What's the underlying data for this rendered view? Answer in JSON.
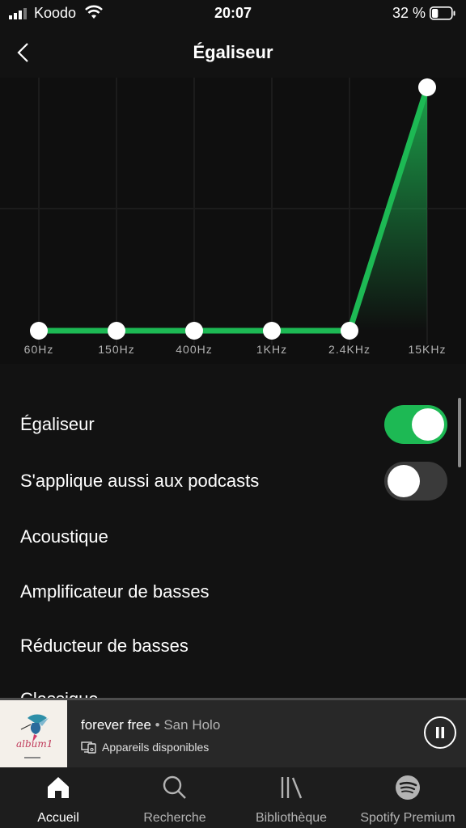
{
  "status": {
    "carrier": "Koodo",
    "time": "20:07",
    "battery": "32 %",
    "battery_level_percent": 32
  },
  "header": {
    "title": "Égaliseur",
    "back_icon": "chevron-left-icon"
  },
  "equalizer": {
    "bands": [
      "60Hz",
      "150Hz",
      "400Hz",
      "1KHz",
      "2.4KHz",
      "15KHz"
    ],
    "levels": [
      0,
      0,
      0,
      0,
      0,
      1
    ],
    "accent": "#1db954"
  },
  "settings": [
    {
      "label": "Égaliseur",
      "toggle": true
    },
    {
      "label": "S'applique aussi aux podcasts",
      "toggle": false
    },
    {
      "label": "Acoustique"
    },
    {
      "label": "Amplificateur de basses"
    },
    {
      "label": "Réducteur de basses"
    }
  ],
  "partial_item": "Classique",
  "now_playing": {
    "track": "forever free",
    "separator": " • ",
    "artist": "San Holo",
    "devices": "Appareils disponibles",
    "album_text": "album1"
  },
  "nav": [
    {
      "label": "Accueil",
      "icon": "home-icon",
      "active": true
    },
    {
      "label": "Recherche",
      "icon": "search-icon",
      "active": false
    },
    {
      "label": "Bibliothèque",
      "icon": "library-icon",
      "active": false
    },
    {
      "label": "Spotify Premium",
      "icon": "spotify-icon",
      "active": false
    }
  ]
}
